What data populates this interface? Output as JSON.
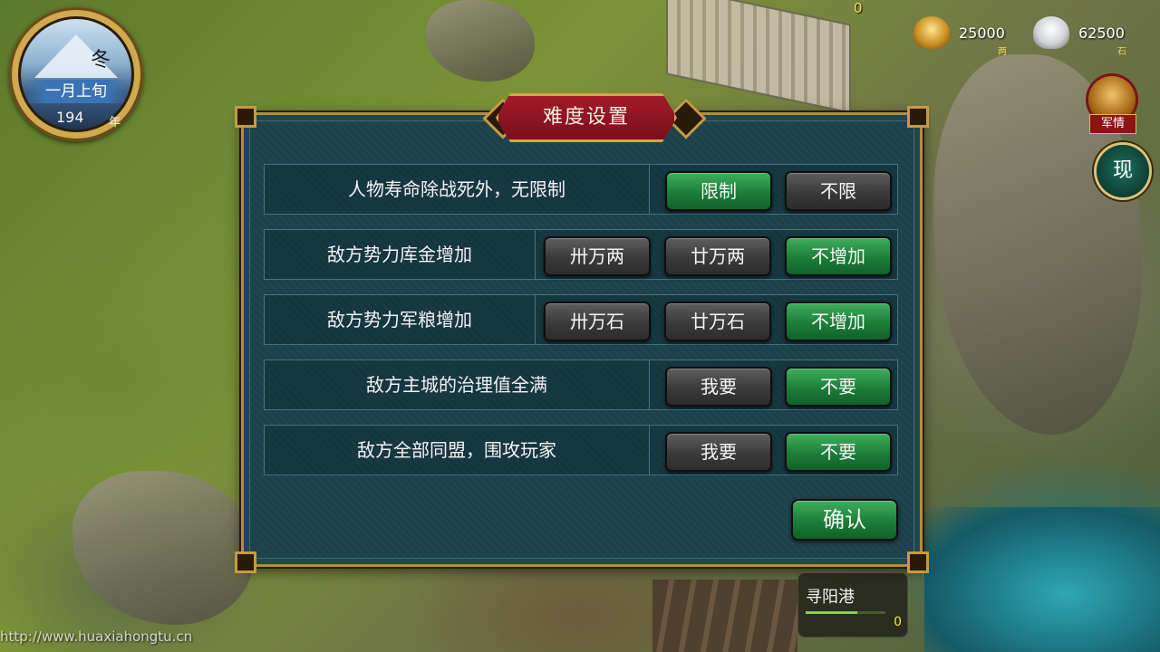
{
  "season_dial": {
    "season": "冬",
    "month_period": "一月上旬",
    "year": "194",
    "year_unit": "年"
  },
  "resources": {
    "gold": {
      "value": "25000",
      "unit": "两",
      "icon": "gold-icon"
    },
    "rice": {
      "value": "62500",
      "unit": "石",
      "icon": "rice-icon"
    }
  },
  "map_counter": "0",
  "military_intel": {
    "label": "军情",
    "icon": "war-drum-icon"
  },
  "show_button": {
    "label": "现"
  },
  "dialog": {
    "title": "难度设置",
    "rows": [
      {
        "label": "人物寿命除战死外，无限制",
        "options": [
          {
            "label": "限制",
            "selected": true
          },
          {
            "label": "不限",
            "selected": false
          }
        ]
      },
      {
        "label": "敌方势力库金增加",
        "options": [
          {
            "label": "卅万两",
            "selected": false
          },
          {
            "label": "廿万两",
            "selected": false
          },
          {
            "label": "不增加",
            "selected": true
          }
        ]
      },
      {
        "label": "敌方势力军粮增加",
        "options": [
          {
            "label": "卅万石",
            "selected": false
          },
          {
            "label": "廿万石",
            "selected": false
          },
          {
            "label": "不增加",
            "selected": true
          }
        ]
      },
      {
        "label": "敌方主城的治理值全满",
        "options": [
          {
            "label": "我要",
            "selected": false
          },
          {
            "label": "不要",
            "selected": true
          }
        ]
      },
      {
        "label": "敌方全部同盟，围攻玩家",
        "options": [
          {
            "label": "我要",
            "selected": false
          },
          {
            "label": "不要",
            "selected": true
          }
        ]
      }
    ],
    "confirm_label": "确认"
  },
  "city": {
    "name": "寻阳港",
    "value": "0",
    "progress": 0.65
  },
  "watermark": "http://www.huaxiahongtu.cn",
  "colors": {
    "selected_green": "#1c7e38",
    "unselected_grey": "#3a3a3a",
    "title_red": "#8c1424",
    "dialog_teal": "#1f4751",
    "gold_trim": "#b58d3b"
  }
}
